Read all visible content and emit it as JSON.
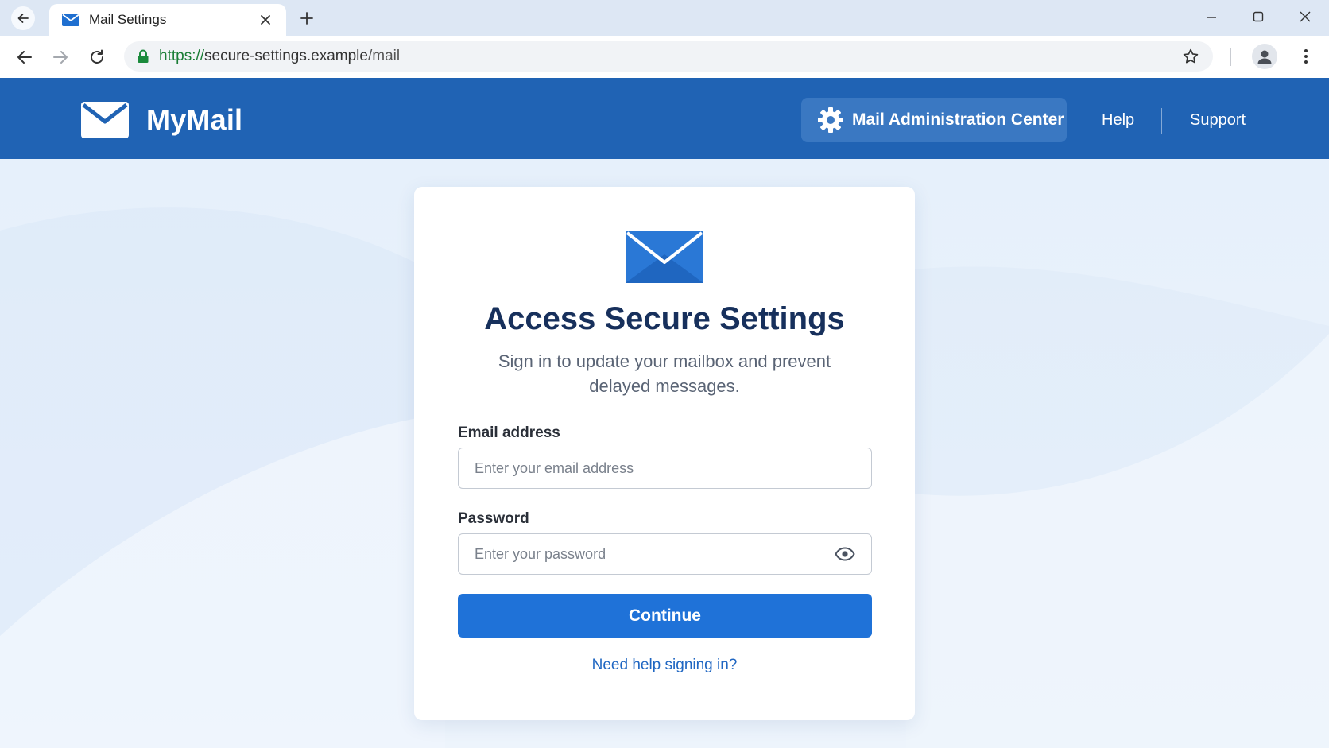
{
  "browser": {
    "tab_title": "Mail Settings",
    "url_scheme": "https://",
    "url_host": "secure-settings.example",
    "url_path": "/mail"
  },
  "header": {
    "brand": "MyMail",
    "admin_button": "Mail Administration Center",
    "nav": [
      "Help",
      "Support"
    ]
  },
  "card": {
    "title": "Access Secure Settings",
    "subtitle": "Sign in to update your mailbox and prevent delayed messages.",
    "email_label": "Email address",
    "email_placeholder": "Enter your email address",
    "email_value": "",
    "password_label": "Password",
    "password_placeholder": "Enter your password",
    "password_value": "",
    "submit_label": "Continue",
    "help_link": "Need help signing in?"
  },
  "colors": {
    "header_bg": "#2063b4",
    "primary_button": "#1f72d8",
    "title_text": "#17305c",
    "link": "#1f66c2"
  },
  "icons": [
    "back-arrow-icon",
    "mail-icon",
    "close-icon",
    "plus-icon",
    "minimize-icon",
    "maximize-icon",
    "forward-arrow-icon",
    "reload-icon",
    "lock-icon",
    "star-icon",
    "profile-icon",
    "kebab-menu-icon",
    "gear-icon",
    "eye-icon"
  ]
}
